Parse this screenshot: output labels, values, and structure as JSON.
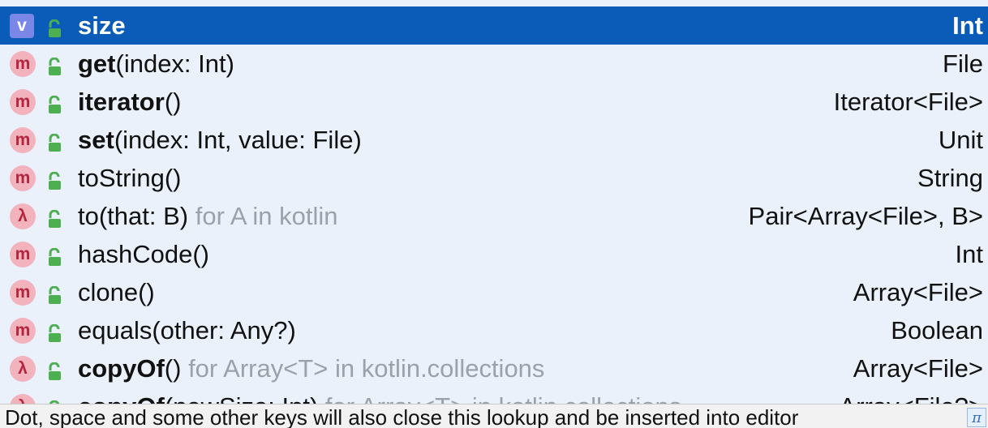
{
  "items": [
    {
      "kind": "v",
      "name": "size",
      "params": "",
      "suffix": "",
      "type": "Int",
      "bold": true,
      "selected": true
    },
    {
      "kind": "m",
      "name": "get",
      "params": "(index: Int)",
      "suffix": "",
      "type": "File",
      "bold": true
    },
    {
      "kind": "m",
      "name": "iterator",
      "params": "()",
      "suffix": "",
      "type": "Iterator<File>",
      "bold": true
    },
    {
      "kind": "m",
      "name": "set",
      "params": "(index: Int, value: File)",
      "suffix": "",
      "type": "Unit",
      "bold": true
    },
    {
      "kind": "m",
      "name": "toString",
      "params": "()",
      "suffix": "",
      "type": "String",
      "bold": false
    },
    {
      "kind": "λ",
      "name": "to",
      "params": "(that: B)",
      "suffix": " for A in kotlin",
      "type": "Pair<Array<File>, B>",
      "bold": false
    },
    {
      "kind": "m",
      "name": "hashCode",
      "params": "()",
      "suffix": "",
      "type": "Int",
      "bold": false
    },
    {
      "kind": "m",
      "name": "clone",
      "params": "()",
      "suffix": "",
      "type": "Array<File>",
      "bold": false
    },
    {
      "kind": "m",
      "name": "equals",
      "params": "(other: Any?)",
      "suffix": "",
      "type": "Boolean",
      "bold": false
    },
    {
      "kind": "λ",
      "name": "copyOf",
      "params": "()",
      "suffix": " for Array<T> in kotlin.collections",
      "type": "Array<File>",
      "bold": true
    },
    {
      "kind": "λ",
      "name": "copyOf",
      "params": "(newSize: Int)",
      "suffix": " for Array<T> in kotlin.collections",
      "type": "Array<File?>",
      "bold": true,
      "cut": true
    }
  ],
  "hint": "Dot, space and some other keys will also close this lookup and be inserted into editor",
  "pi_symbol": "π",
  "colors": {
    "selection": "#0b5cb8",
    "method_badge": "#f2b3bd",
    "variable_badge": "#7b87e6",
    "lock": "#4caf50"
  }
}
